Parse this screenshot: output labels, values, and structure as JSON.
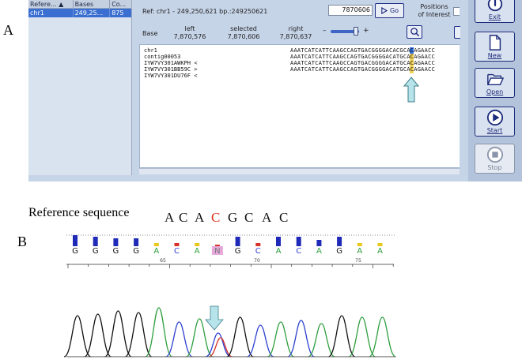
{
  "figure": {
    "panel_a_letter": "A",
    "panel_b_letter": "B"
  },
  "reference_table": {
    "headers": [
      "Refere... ▲",
      "Bases",
      "Co..."
    ],
    "rows": [
      [
        "chr1",
        "249,25...",
        "875"
      ]
    ]
  },
  "viewer": {
    "ref_line": "Ref:  chr1 - 249,250,621 bp.:249250621",
    "position_value": "7870606",
    "go_label": "Go",
    "poi_line1": "Positions",
    "poi_line2": "of Interest",
    "base_label": "Base",
    "left_label": "left",
    "left_value": "7,870,576",
    "selected_label": "selected",
    "selected_value": "7,870,606",
    "right_label": "right",
    "right_value": "7,870,637",
    "zoom_minus": "–",
    "zoom_plus": "+"
  },
  "alignment": [
    {
      "name": "chr1",
      "bases": "AAATCATCATTCAAGCCAGTGACGGGGACACGCACAGAACC"
    },
    {
      "name": "contig00053",
      "bases": "AAATCATCATTCAAGCCAGTGACGGGGACATGCACAGAACC"
    },
    {
      "name": "IYW7VY301AWKPH <",
      "bases": "AAATCATCATTCAAGCCAGTGACGGGGACATGCACAGAACC"
    },
    {
      "name": "IYW7VY301BB59C >",
      "bases": "AAATCATCATTCAAGCCAGTGACGGGGACATGCACAGAACC"
    },
    {
      "name": "IYW7VY301DU76F <",
      "bases": ""
    }
  ],
  "side_buttons": {
    "exit": "Exit",
    "new": "New",
    "open": "Open",
    "start": "Start",
    "stop": "Stop"
  },
  "chromatogram": {
    "reference_label": "Reference sequence",
    "reference_letters": [
      "A",
      "C",
      "A",
      "C",
      "G",
      "C",
      "A",
      "C"
    ],
    "base_calls": [
      "G",
      "G",
      "G",
      "G",
      "A",
      "C",
      "A",
      "N",
      "G",
      "C",
      "A",
      "C",
      "A",
      "G",
      "A",
      "A"
    ],
    "positions": [
      "65",
      "70",
      "75"
    ]
  },
  "colors": {
    "selected_column": "#f2d35a",
    "highlight_reference": "#e0321f",
    "quality_bar": "#1f2ab8",
    "trace_A": "#2e9e3e",
    "trace_C": "#2b3fd0",
    "trace_G": "#111111",
    "trace_T": "#d8312a",
    "arrow": "#b7e3ea"
  }
}
